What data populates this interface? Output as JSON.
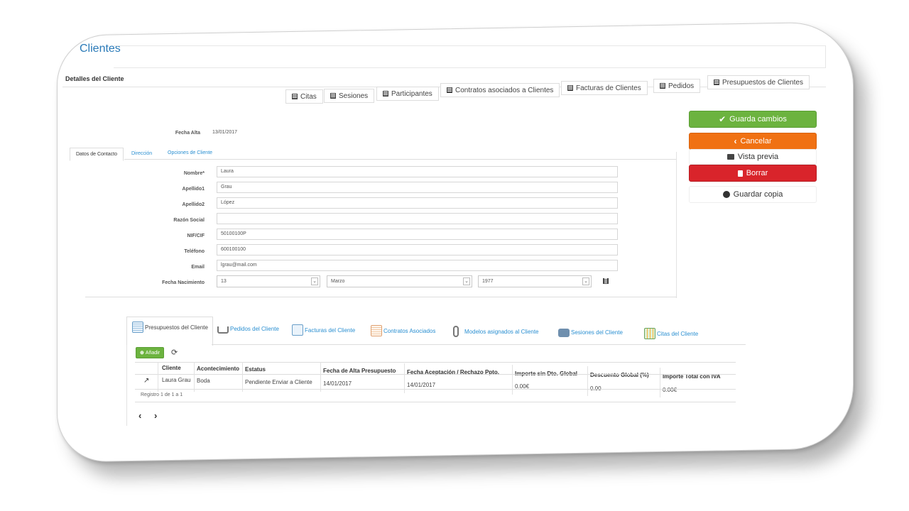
{
  "header": {
    "title": "Clientes",
    "section": "Detalles del Cliente"
  },
  "top_tabs": [
    "Citas",
    "Sesiones",
    "Participantes",
    "Contratos asociados a Clientes",
    "Facturas de Clientes",
    "Pedidos",
    "Presupuestos de Clientes"
  ],
  "fecha_alta": {
    "label": "Fecha Alta",
    "value": "13/01/2017"
  },
  "form_tabs": [
    "Datos de Contacto",
    "Dirección",
    "Opciones de Cliente"
  ],
  "form": {
    "nombre": {
      "label": "Nombre*",
      "value": "Laura"
    },
    "apellido1": {
      "label": "Apellido1",
      "value": "Grau"
    },
    "apellido2": {
      "label": "Apellido2",
      "value": "López"
    },
    "razon": {
      "label": "Razón Social",
      "value": ""
    },
    "nif": {
      "label": "NIF/CIF",
      "value": "50100100P"
    },
    "telefono": {
      "label": "Teléfono",
      "value": "600100100"
    },
    "email": {
      "label": "Email",
      "value": "lgrau@mail.com"
    },
    "nacimiento": {
      "label": "Fecha Nacimiento",
      "day": "13",
      "month": "Marzo",
      "year": "1977"
    }
  },
  "actions": {
    "save": "Guarda cambios",
    "cancel": "Cancelar",
    "preview": "Vista previa",
    "delete": "Borrar",
    "save_copy": "Guardar copia"
  },
  "colors": {
    "save": "#6cb33f",
    "cancel": "#f07113",
    "delete": "#d9242b",
    "link": "#2a8fd1",
    "title": "#2a7ab8"
  },
  "bottom_tabs": [
    "Presupuestos del Cliente",
    "Pedidos del Cliente",
    "Facturas del Cliente",
    "Contratos Asociados",
    "Modelos asignados al Cliente",
    "Sesiones del Cliente",
    "Citas del Cliente"
  ],
  "table": {
    "add_label": "Añadir",
    "columns": [
      "Cliente",
      "Acontecimiento",
      "Estatus",
      "Fecha de Alta Presupuesto",
      "Fecha Aceptación / Rechazo Ppto.",
      "Importe sin Dto. Global",
      "Descuento Global (%)",
      "Importe Total con IVA"
    ],
    "rows": [
      [
        "Laura Grau",
        "Boda",
        "Pendiente Enviar a Cliente",
        "14/01/2017",
        "14/01/2017",
        "0.00€",
        "0.00",
        "0.00€"
      ]
    ],
    "footer": "Registro 1 de 1 a 1",
    "pager": {
      "prev": "‹",
      "next": "›"
    }
  }
}
